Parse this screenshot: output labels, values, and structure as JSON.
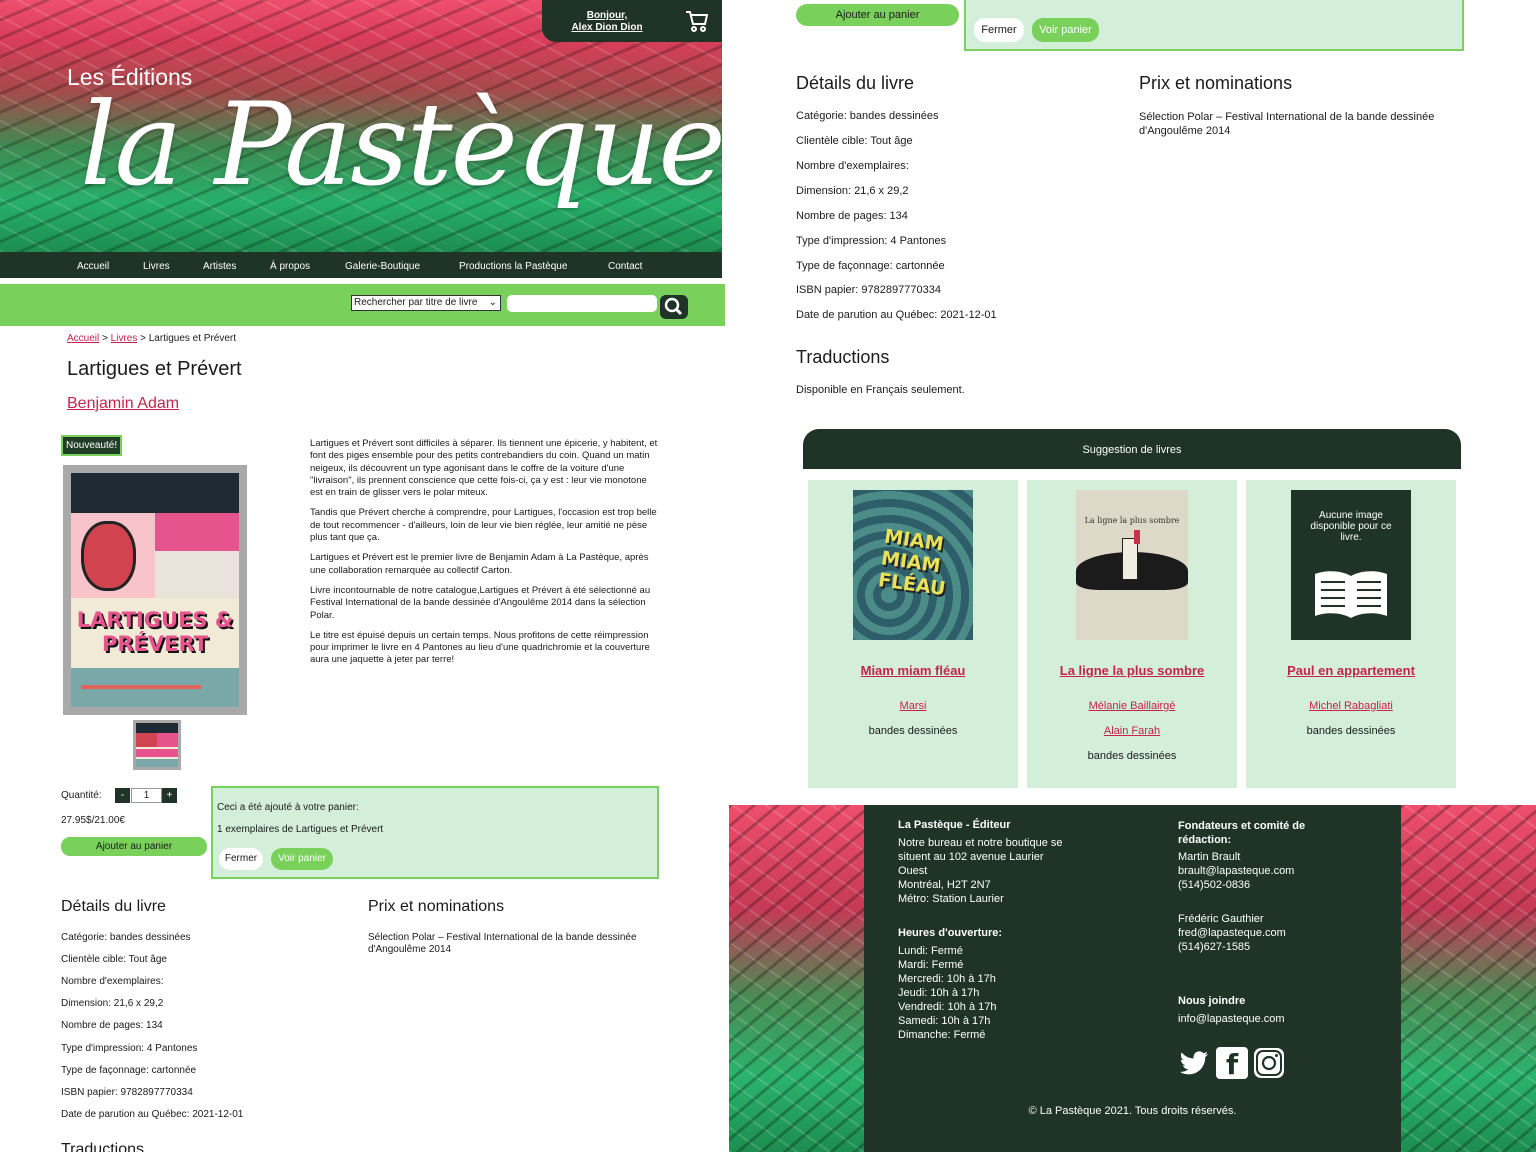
{
  "header": {
    "pre_title": "Les Éditions",
    "logo_text": "la Pastèque",
    "greeting_line1": "Bonjour,",
    "greeting_line2": "Alex Dion Dion"
  },
  "nav": [
    "Accueil",
    "Livres",
    "Artistes",
    "À propos",
    "Galerie-Boutique",
    "Productions la Pastèque",
    "Contact"
  ],
  "search": {
    "select_value": "Rechercher par titre de livre",
    "input_value": ""
  },
  "breadcrumb": {
    "home": "Accueil",
    "books": "Livres",
    "current": "Lartigues et Prévert",
    "sep": ">"
  },
  "book": {
    "title": "Lartigues et Prévert",
    "author": "Benjamin Adam",
    "badge": "Nouveauté!",
    "description": [
      "Lartigues et Prévert sont difficiles à séparer. Ils tiennent une épicerie, y habitent, et font des piges ensemble pour des petits contrebandiers du coin. Quand un matin neigeux, ils découvrent un type agonisant dans le coffre de la voiture d'une \"livraison\", ils prennent conscience que cette fois-ci, ça y est : leur vie monotone est en train de glisser vers le polar miteux.",
      "Tandis que Prévert cherche à comprendre, pour Lartigues, l'occasion est trop belle de tout recommencer - d'ailleurs, loin de leur vie bien réglée, leur amitié ne pèse plus tant que ça.",
      "Lartigues et Prévert est le premier livre de Benjamin Adam à La Pastèque, après une collaboration remarquée au collectif Carton.",
      "Livre incontournable de notre catalogue,Lartigues et Prévert à été sélectionné au Festival International de la bande dessinée d'Angoulême 2014 dans la sélection Polar.",
      "Le titre est épuisé depuis un certain temps. Nous profitons de cette réimpression pour imprimer le livre en 4 Pantones au lieu d'une quadrichromie et la couverture aura une jaquette à jeter par terre!"
    ],
    "cover_title": "LARTIGUES & PRÉVERT"
  },
  "purchase": {
    "qty_label": "Quantité:",
    "qty_minus": "-",
    "qty_value": "1",
    "qty_plus": "+",
    "price": "27.95$/21.00€",
    "add_to_cart": "Ajouter au panier"
  },
  "cart_panel": {
    "line1": "Ceci a été ajouté à votre panier:",
    "line2": "1 exemplaires de Lartigues et Prévert",
    "close": "Fermer",
    "view": "Voir panier"
  },
  "details": {
    "heading": "Détails du livre",
    "items": [
      "Catégorie: bandes dessinées",
      "Clientèle cible: Tout âge",
      "Nombre d'exemplaires:",
      "Dimension: 21,6 x 29,2",
      "Nombre de pages: 134",
      "Type d'impression: 4 Pantones",
      "Type de façonnage: cartonnée",
      "ISBN papier: 9782897770334",
      "Date de parution au Québec: 2021-12-01"
    ]
  },
  "awards": {
    "heading": "Prix et nominations",
    "text": "Sélection Polar – Festival International de la bande dessinée d'Angoulême 2014"
  },
  "translations": {
    "heading": "Traductions",
    "text": "Disponible en Français seulement."
  },
  "suggestions": {
    "heading": "Suggestion de livres",
    "items": [
      {
        "title": "Miam miam fléau",
        "authors": [
          "Marsi"
        ],
        "category": "bandes dessinées",
        "cover_text": "MIAM MIAM FLÉAU"
      },
      {
        "title": "La ligne la plus sombre",
        "authors": [
          "Mélanie Baillairgé",
          "Alain Farah"
        ],
        "category": "bandes dessinées",
        "cover_text": "La ligne la plus sombre"
      },
      {
        "title": "Paul en appartement",
        "authors": [
          "Michel Rabagliati"
        ],
        "category": "bandes dessinées",
        "cover_text": "Aucune image disponible pour ce livre."
      }
    ]
  },
  "footer": {
    "col1_heading": "La Pastèque - Éditeur",
    "col1_text": "Notre bureau et notre boutique se\nsituent au 102 avenue Laurier\nOuest\nMontréal, H2T 2N7\nMétro: Station Laurier",
    "hours_heading": "Heures d'ouverture:",
    "hours_text": "Lundi: Fermé\nMardi: Fermé\nMercredi: 10h à 17h\nJeudi: 10h à 17h\nVendredi: 10h à 17h\nSamedi: 10h à 17h\nDimanche: Fermé",
    "col2_heading": "Fondateurs et comité de\nrédaction:",
    "founder1": "Martin Brault\nbrault@lapasteque.com\n(514)502-0836",
    "founder2": "Frédéric Gauthier\nfred@lapasteque.com\n(514)627-1585",
    "contact_heading": "Nous joindre",
    "contact_email": "info@lapasteque.com",
    "copyright": "© La Pastèque 2021. Tous droits réservés."
  },
  "colors": {
    "dark_green": "#1f3426",
    "accent_green": "#79d15b",
    "panel_green": "#d3efda",
    "link_pink": "#c4244d"
  }
}
